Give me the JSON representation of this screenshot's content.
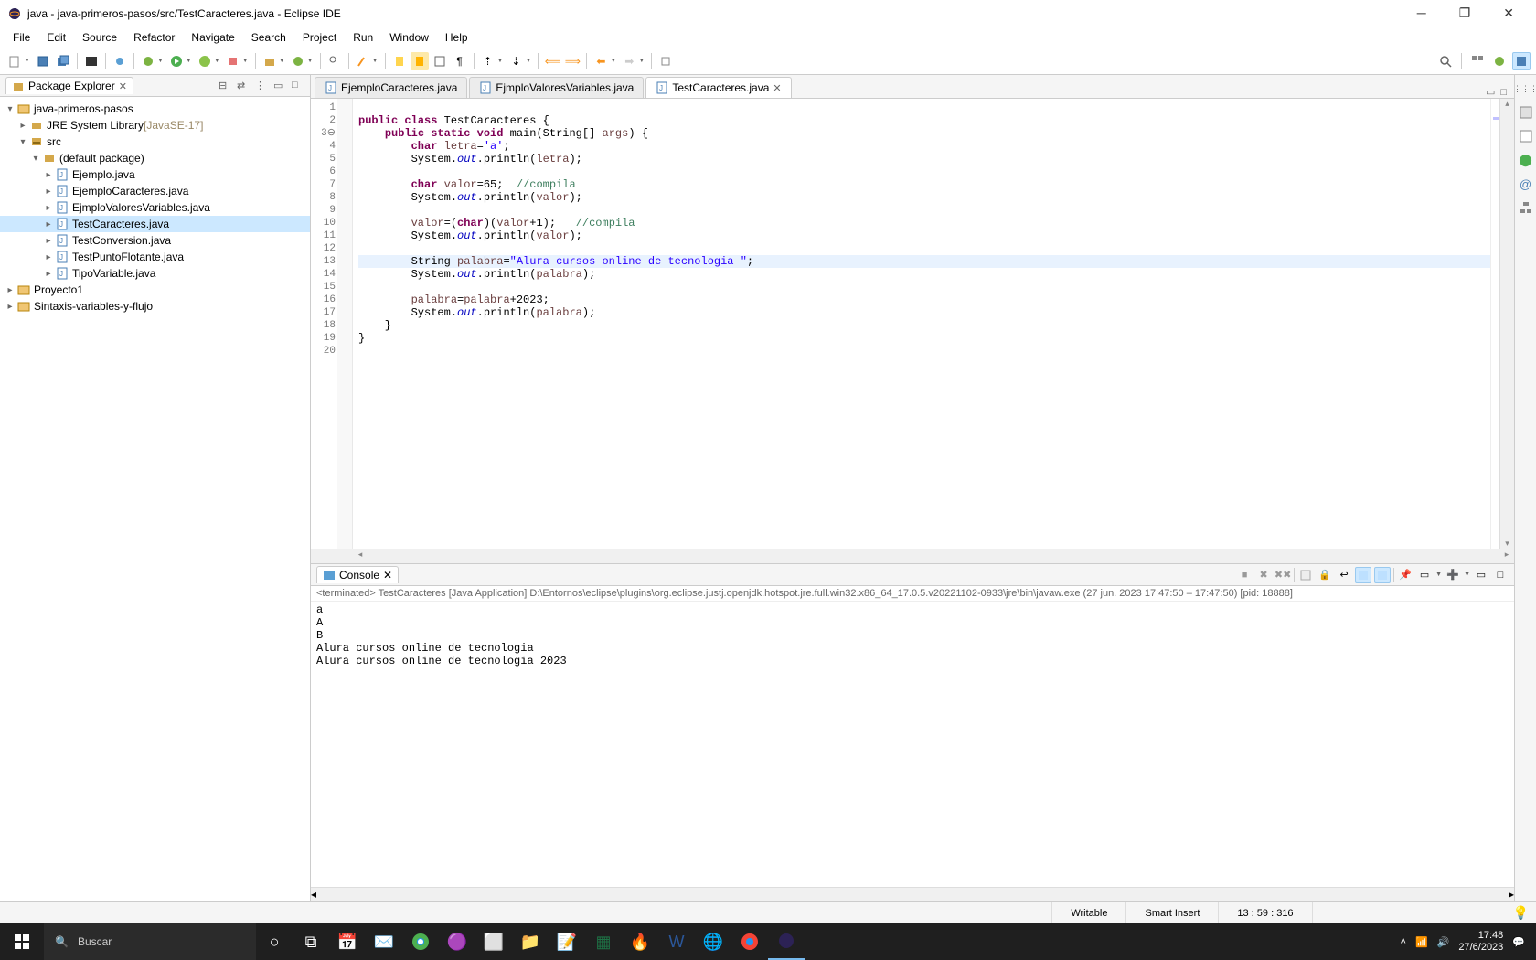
{
  "window": {
    "title": "java - java-primeros-pasos/src/TestCaracteres.java - Eclipse IDE"
  },
  "menu": [
    "File",
    "Edit",
    "Source",
    "Refactor",
    "Navigate",
    "Search",
    "Project",
    "Run",
    "Window",
    "Help"
  ],
  "packageExplorer": {
    "title": "Package Explorer",
    "tree": [
      {
        "level": 0,
        "expand": "▾",
        "icon": "project",
        "label": "java-primeros-pasos"
      },
      {
        "level": 1,
        "expand": "▸",
        "icon": "jre",
        "label": "JRE System Library",
        "extra": " [JavaSE-17]"
      },
      {
        "level": 1,
        "expand": "▾",
        "icon": "src",
        "label": "src"
      },
      {
        "level": 2,
        "expand": "▾",
        "icon": "package",
        "label": "(default package)"
      },
      {
        "level": 3,
        "expand": "▸",
        "icon": "java",
        "label": "Ejemplo.java"
      },
      {
        "level": 3,
        "expand": "▸",
        "icon": "java",
        "label": "EjemploCaracteres.java"
      },
      {
        "level": 3,
        "expand": "▸",
        "icon": "java",
        "label": "EjmploValoresVariables.java"
      },
      {
        "level": 3,
        "expand": "▸",
        "icon": "java",
        "label": "TestCaracteres.java",
        "selected": true
      },
      {
        "level": 3,
        "expand": "▸",
        "icon": "java",
        "label": "TestConversion.java"
      },
      {
        "level": 3,
        "expand": "▸",
        "icon": "java",
        "label": "TestPuntoFlotante.java"
      },
      {
        "level": 3,
        "expand": "▸",
        "icon": "java",
        "label": "TipoVariable.java"
      },
      {
        "level": 0,
        "expand": "▸",
        "icon": "project",
        "label": "Proyecto1"
      },
      {
        "level": 0,
        "expand": "▸",
        "icon": "project",
        "label": "Sintaxis-variables-y-flujo"
      }
    ]
  },
  "editorTabs": [
    {
      "label": "EjemploCaracteres.java",
      "active": false
    },
    {
      "label": "EjmploValoresVariables.java",
      "active": false
    },
    {
      "label": "TestCaracteres.java",
      "active": true
    }
  ],
  "code": {
    "lines": [
      {
        "n": 1,
        "html": ""
      },
      {
        "n": 2,
        "html": "<span class='kw'>public</span> <span class='kw'>class</span> TestCaracteres {"
      },
      {
        "n": "3⊖",
        "html": "    <span class='kw'>public</span> <span class='kw'>static</span> <span class='kw'>void</span> main(String[] <span class='var'>args</span>) {"
      },
      {
        "n": 4,
        "html": "        <span class='kw'>char</span> <span class='var'>letra</span>=<span class='str'>'a'</span>;"
      },
      {
        "n": 5,
        "html": "        System.<span class='field'>out</span>.println(<span class='var'>letra</span>);"
      },
      {
        "n": 6,
        "html": ""
      },
      {
        "n": 7,
        "html": "        <span class='kw'>char</span> <span class='var'>valor</span>=65;  <span class='com'>//compila</span>"
      },
      {
        "n": 8,
        "html": "        System.<span class='field'>out</span>.println(<span class='var'>valor</span>);"
      },
      {
        "n": 9,
        "html": ""
      },
      {
        "n": 10,
        "html": "        <span class='var'>valor</span>=(<span class='kw'>char</span>)(<span class='var'>valor</span>+1);   <span class='com'>//compila</span>"
      },
      {
        "n": 11,
        "html": "        System.<span class='field'>out</span>.println(<span class='var'>valor</span>);"
      },
      {
        "n": 12,
        "html": ""
      },
      {
        "n": 13,
        "hl": true,
        "html": "        String <span class='var'>palabra</span>=<span class='str'>\"Alura cursos online de tecnologia \"</span>;"
      },
      {
        "n": 14,
        "html": "        System.<span class='field'>out</span>.println(<span class='var'>palabra</span>);"
      },
      {
        "n": 15,
        "html": ""
      },
      {
        "n": 16,
        "html": "        <span class='var'>palabra</span>=<span class='var'>palabra</span>+2023;"
      },
      {
        "n": 17,
        "html": "        System.<span class='field'>out</span>.println(<span class='var'>palabra</span>);"
      },
      {
        "n": 18,
        "html": "    }"
      },
      {
        "n": 19,
        "html": "}"
      },
      {
        "n": 20,
        "html": ""
      }
    ]
  },
  "console": {
    "title": "Console",
    "info": "<terminated> TestCaracteres [Java Application] D:\\Entornos\\eclipse\\plugins\\org.eclipse.justj.openjdk.hotspot.jre.full.win32.x86_64_17.0.5.v20221102-0933\\jre\\bin\\javaw.exe  (27 jun. 2023 17:47:50 – 17:47:50) [pid: 18888]",
    "output": "a\nA\nB\nAlura cursos online de tecnologia \nAlura cursos online de tecnologia 2023"
  },
  "status": {
    "writable": "Writable",
    "insert": "Smart Insert",
    "pos": "13 : 59 : 316"
  },
  "taskbar": {
    "search_placeholder": "Buscar",
    "time": "17:48",
    "date": "27/6/2023"
  }
}
